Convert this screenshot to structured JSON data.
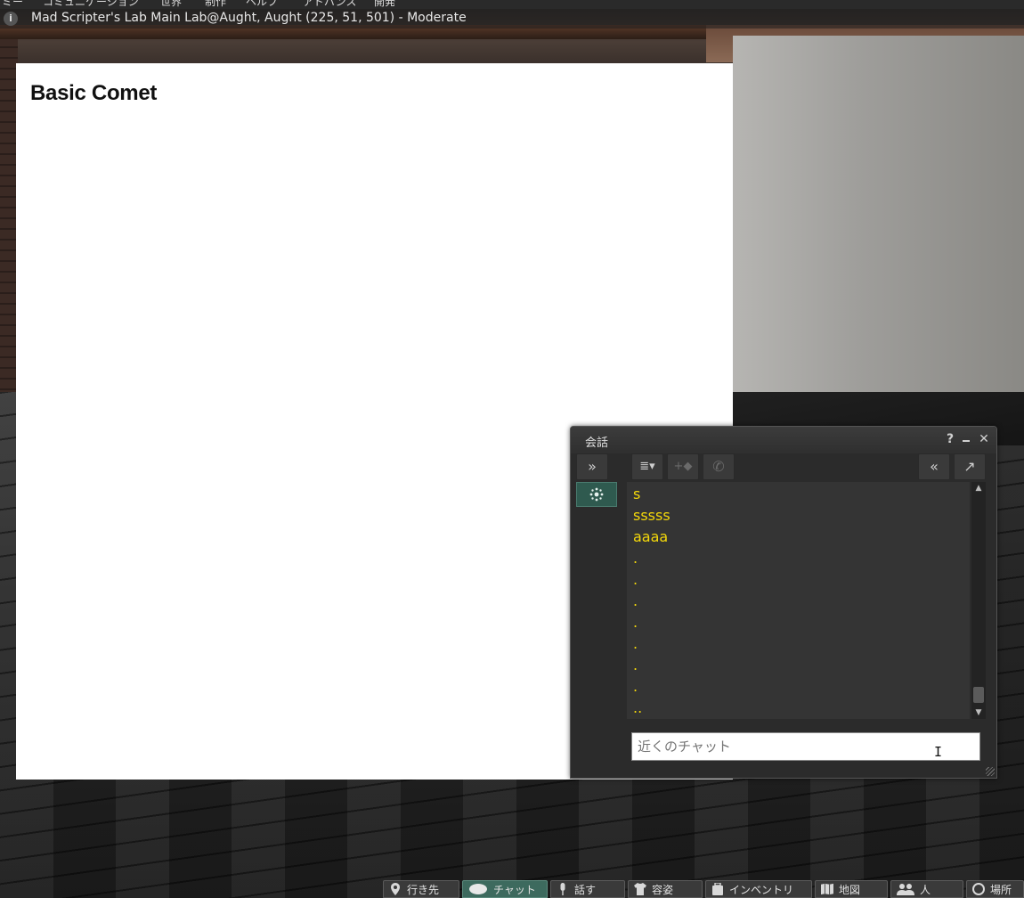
{
  "menubar": {
    "items": [
      "ミー",
      "コミュニケーション",
      "世界",
      "制作",
      "ヘルプ",
      "アドバンス",
      "開発"
    ]
  },
  "location_bar": {
    "text": "Mad Scripter's Lab Main Lab@Aught, Aught (225, 51, 501) - Moderate",
    "icon": "info-icon"
  },
  "media_panel": {
    "title": "Basic Comet"
  },
  "chat_floater": {
    "title": "会話",
    "help": "?",
    "minimize": "‗",
    "close": "✕",
    "toolbar": {
      "expand_icon": "double-chevron-right-icon",
      "options_icon": "list-menu-icon",
      "add_person_icon": "add-person-icon",
      "call_icon": "phone-icon",
      "collapse_icon": "double-chevron-left-icon",
      "tear_off_icon": "arrow-up-right-icon"
    },
    "nearby_tab_icon": "nearby-chat-icon",
    "messages": [
      "s",
      "sssss",
      "aaaa",
      ".",
      ".",
      ".",
      ".",
      ".",
      ".",
      ".",
      ".."
    ],
    "input_placeholder": "近くのチャット",
    "text_color": "#f5d90a"
  },
  "bottom_toolbar": {
    "buttons": [
      {
        "label": "行き先",
        "icon": "map-pin-icon",
        "active": false
      },
      {
        "label": "チャット",
        "icon": "speech-bubble-icon",
        "active": true
      },
      {
        "label": "話す",
        "icon": "microphone-icon",
        "active": false
      },
      {
        "label": "容姿",
        "icon": "shirt-icon",
        "active": false
      },
      {
        "label": "インベントリ",
        "icon": "suitcase-icon",
        "active": false
      },
      {
        "label": "地図",
        "icon": "map-icon",
        "active": false
      },
      {
        "label": "人",
        "icon": "people-icon",
        "active": false
      },
      {
        "label": "場所",
        "icon": "places-icon",
        "active": false
      }
    ],
    "active_color": "#3d6a5e"
  }
}
